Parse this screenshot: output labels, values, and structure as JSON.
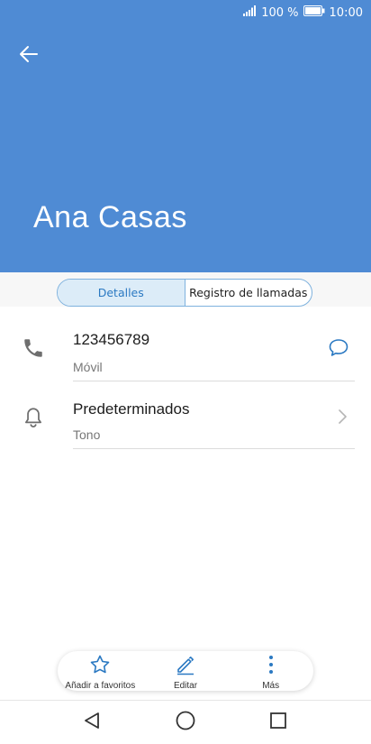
{
  "status_bar": {
    "battery_percent": "100 %",
    "time": "10:00"
  },
  "contact": {
    "name": "Ana Casas"
  },
  "tabs": [
    {
      "label": "Detalles",
      "active": true
    },
    {
      "label": "Registro de llamadas",
      "active": false
    }
  ],
  "details": {
    "phone": {
      "number": "123456789",
      "type": "Móvil",
      "icon": "phone-icon",
      "action_icon": "message-icon"
    },
    "ringtone": {
      "value": "Predeterminados",
      "label": "Tono",
      "icon": "bell-icon",
      "action_icon": "chevron-right-icon"
    }
  },
  "bottom_actions": [
    {
      "label": "Añadir a favoritos",
      "icon": "star-icon"
    },
    {
      "label": "Editar",
      "icon": "pencil-icon"
    },
    {
      "label": "Más",
      "icon": "more-vertical-icon"
    }
  ],
  "colors": {
    "header": "#4f8bd4",
    "accent": "#2b79c2"
  }
}
